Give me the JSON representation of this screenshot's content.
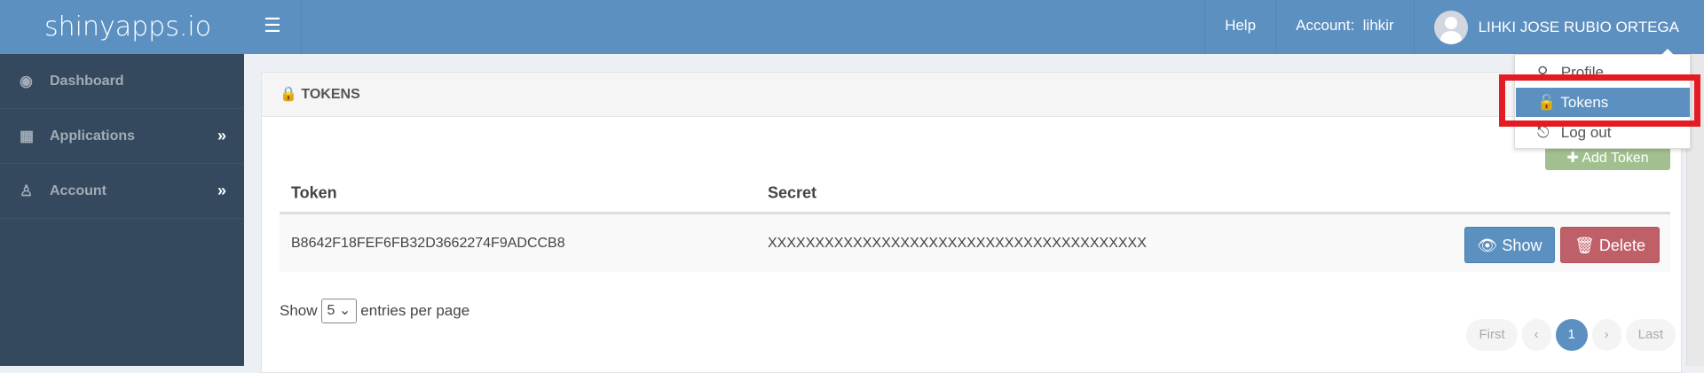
{
  "header": {
    "brand": "shinyapps.io",
    "menu_icon": "hamburger-icon",
    "help": "Help",
    "account_label": "Account:",
    "account_name": "lihkir",
    "user_name": "LIHKI JOSE RUBIO ORTEGA"
  },
  "sidebar": {
    "items": [
      {
        "label": "Dashboard",
        "icon": "dashboard-icon"
      },
      {
        "label": "Applications",
        "icon": "grid-icon"
      },
      {
        "label": "Account",
        "icon": "user-icon"
      }
    ]
  },
  "dropdown": {
    "items": [
      {
        "label": "Profile"
      },
      {
        "label": "Tokens"
      },
      {
        "label": "Log out"
      }
    ]
  },
  "panel": {
    "title": "TOKENS",
    "add_button": "Add Token",
    "columns": [
      "Token",
      "Secret"
    ],
    "rows": [
      {
        "token": "B8642F18FEF6FB32D3662274F9ADCCB8",
        "secret": "XXXXXXXXXXXXXXXXXXXXXXXXXXXXXXXXXXXXXXXX",
        "show": "Show",
        "delete": "Delete"
      }
    ],
    "entries_prefix": "Show",
    "entries_value": "5",
    "entries_suffix": "entries per page",
    "pagination": {
      "first": "First",
      "prev": "‹",
      "page": "1",
      "next": "›",
      "last": "Last"
    }
  },
  "colors": {
    "brand": "#5b90c0",
    "sidebar": "#34495e",
    "danger": "#bf5f68",
    "highlight": "#e31b23"
  }
}
